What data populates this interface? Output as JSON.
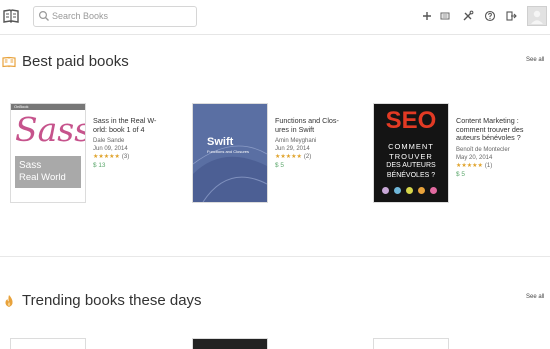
{
  "header": {
    "search": {
      "placeholder": "Search Books",
      "value": ""
    },
    "icons": [
      "logo-book-icon",
      "search-icon",
      "plus-icon",
      "list-icon",
      "tools-icon",
      "help-icon",
      "exit-icon",
      "avatar"
    ]
  },
  "sections": [
    {
      "title": "Best paid books",
      "see_all": "See all",
      "icon": "book-open-icon",
      "books": [
        {
          "title": "Sass in the Real W-\norld: book 1 of 4",
          "author": "Dale Sande",
          "date": "Jun 09, 2014",
          "stars": "★★★★★",
          "rating_count": "(3)",
          "price": "$ 13",
          "cover": {
            "kind": "sass",
            "tag": "OnBook",
            "logo": "Sass",
            "line1": "Sass",
            "line2": "Real World"
          }
        },
        {
          "title": "Functions and Clos-\nures in Swift",
          "author": "Amin Meyghani",
          "date": "Jun 29, 2014",
          "stars": "★★★★★",
          "rating_count": "(2)",
          "price": "$ 5",
          "cover": {
            "kind": "swift",
            "big": "Swift",
            "small": "Functions and Closures"
          }
        },
        {
          "title": "Content Marketing :\ncomment trouver des\nauteurs bénévoles ?",
          "author": "Benoît de Montecler",
          "date": "May 20, 2014",
          "stars": "★★★★★",
          "rating_count": "(1)",
          "price": "$ 5",
          "cover": {
            "kind": "seo",
            "big": "SEO",
            "l1": "COMMENT",
            "l2": "TROUVER",
            "l3": "DES AUTEURS",
            "l4": "BÉNÉVOLES ?"
          }
        }
      ]
    },
    {
      "title": "Trending books these days",
      "see_all": "See all",
      "icon": "flame-icon"
    }
  ],
  "colors": {
    "accent_orange": "#e8a23b",
    "price_green": "#5aa66a",
    "star": "#e0a32b",
    "sass_pink": "#c6538c",
    "swift_blue": "#5a6fa3",
    "seo_red": "#e23a24"
  }
}
